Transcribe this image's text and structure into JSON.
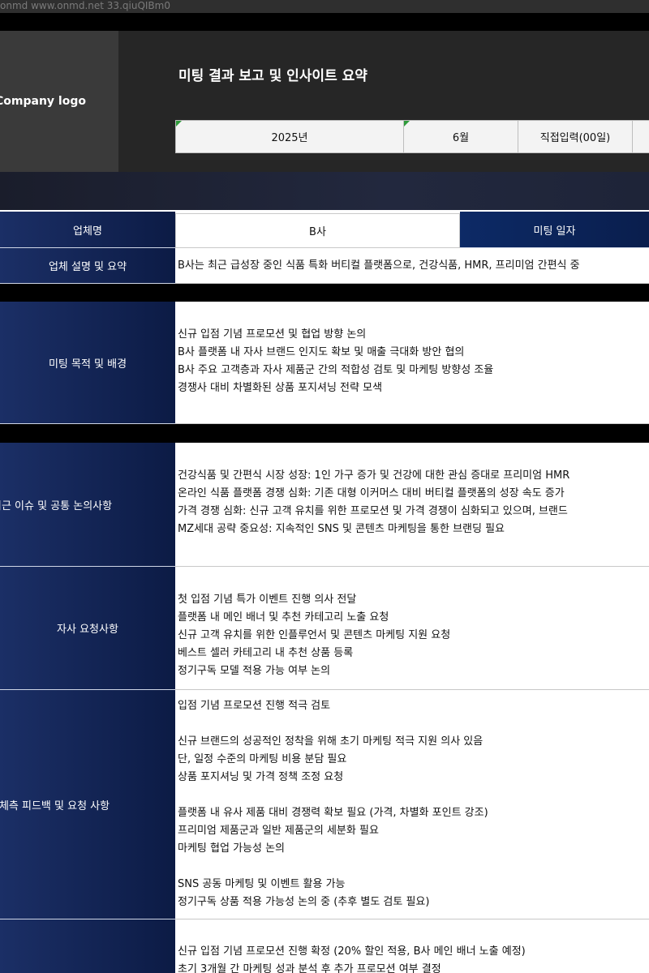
{
  "watermark": "onmd www.onmd.net 33.qiuQIBm0",
  "header": {
    "logo": "Company logo",
    "title": "미팅 결과 보고 및 인사이트 요약",
    "year": "2025년",
    "month": "6월",
    "day": "직접입력(00일)"
  },
  "company": {
    "label": "업체명",
    "value": "B사",
    "meeting_date_label": "미팅 일자"
  },
  "summary": {
    "label": "업체 설명 및 요약",
    "value": "B사는 최근 급성장 중인 식품 특화 버티컬 플랫폼으로, 건강식품, HMR, 프리미엄 간편식 중"
  },
  "purpose": {
    "label": "미팅 목적 및 배경",
    "lines": [
      "신규 입점 기념 프로모션 및 협업 방향 논의",
      "B사 플랫폼 내 자사 브랜드 인지도 확보 및 매출 극대화 방안 협의",
      "B사 주요 고객층과 자사 제품군 간의 적합성 검토 및 마케팅 방향성 조율",
      "경쟁사 대비 차별화된 상품 포지셔닝 전략 모색"
    ]
  },
  "issues": {
    "label": "최근 이슈 및 공통 논의사항",
    "lines": [
      "건강식품 및 간편식 시장 성장: 1인 가구 증가 및 건강에 대한 관심 증대로 프리미엄 HMR",
      "온라인 식품 플랫폼 경쟁 심화: 기존 대형 이커머스 대비 버티컬 플랫폼의 성장 속도 증가",
      "가격 경쟁 심화: 신규 고객 유치를 위한 프로모션 및 가격 경쟁이 심화되고 있으며, 브랜드",
      "MZ세대 공략 중요성: 지속적인 SNS 및 콘텐츠 마케팅을 통한 브랜딩 필요"
    ]
  },
  "requests": {
    "label": "자사 요청사항",
    "lines": [
      "첫 입점 기념 특가 이벤트 진행 의사 전달",
      "플랫폼 내 메인 배너 및 추천 카테고리 노출 요청",
      "신규 고객 유치를 위한 인플루언서 및 콘텐츠 마케팅 지원 요청",
      "베스트 셀러 카테고리 내 추천 상품 등록",
      "정기구독 모델 적용 가능 여부 논의"
    ]
  },
  "feedback": {
    "label": "업체측 피드백 및 요청 사항",
    "lines": [
      "입점 기념 프로모션 진행 적극 검토",
      "",
      "신규 브랜드의 성공적인 정착을 위해 초기 마케팅 적극 지원 의사 있음",
      "단, 일정 수준의 마케팅 비용 분담 필요",
      "상품 포지셔닝 및 가격 정책 조정 요청",
      "",
      "플랫폼 내 유사 제품 대비 경쟁력 확보 필요 (가격, 차별화 포인트 강조)",
      "프리미엄 제품군과 일반 제품군의 세분화 필요",
      "마케팅 협업 가능성 논의",
      "",
      "SNS 공동 마케팅 및 이벤트 활용 가능",
      "정기구독 상품 적용 가능성 논의 중 (추후 별도 검토 필요)"
    ]
  },
  "result": {
    "lines": [
      "신규 입점 기념 프로모션 진행 확정 (20% 할인 적용, B사 메인 배너 노출 예정)",
      "초기 3개월 간 마케팅 성과 분석 후 추가 프로모션 여부 결정"
    ]
  }
}
